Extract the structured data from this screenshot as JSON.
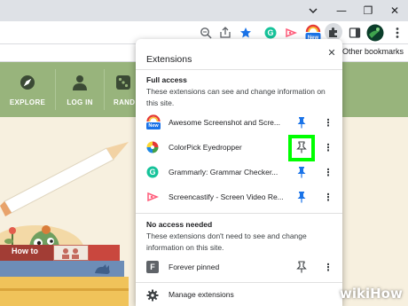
{
  "browser": {
    "window_controls": {
      "minimize": "—",
      "restore": "❐",
      "close": "✕"
    },
    "bookmarks_bar": {
      "other_bookmarks": "Other bookmarks"
    },
    "toolbar_icons": [
      "zoom-icon",
      "share-icon",
      "star-icon",
      "grammarly-icon",
      "screencastify-icon",
      "awesome-screenshot-icon",
      "puzzle-icon",
      "sidebar-icon",
      "profile-icon",
      "menu-icon"
    ],
    "new_badge": "New"
  },
  "website": {
    "nav": [
      {
        "label": "EXPLORE",
        "icon": "compass-icon"
      },
      {
        "label": "LOG IN",
        "icon": "person-icon"
      },
      {
        "label": "RAND",
        "icon": "dice-icon"
      }
    ],
    "book_label": "How to",
    "colors": {
      "nav_green": "#98b47c",
      "background": "#f7f0df"
    }
  },
  "extensions_popup": {
    "title": "Extensions",
    "close_label": "✕",
    "full_access": {
      "heading": "Full access",
      "description": "These extensions can see and change information on this site.",
      "items": [
        {
          "name": "Awesome Screenshot and Scre...",
          "icon": "awesome-screenshot-icon",
          "badge": "New",
          "pinned": true
        },
        {
          "name": "ColorPick Eyedropper",
          "icon": "colorpick-icon",
          "pinned": false,
          "highlighted": true
        },
        {
          "name": "Grammarly: Grammar Checker...",
          "icon": "grammarly-icon",
          "pinned": true
        },
        {
          "name": "Screencastify - Screen Video Re...",
          "icon": "screencastify-icon",
          "pinned": true
        }
      ]
    },
    "no_access": {
      "heading": "No access needed",
      "description": "These extensions don't need to see and change information on this site.",
      "items": [
        {
          "name": "Forever pinned",
          "icon": "forever-pinned-icon",
          "icon_letter": "F",
          "pinned": false
        }
      ]
    },
    "manage_label": "Manage extensions",
    "highlight_color": "#00ff00",
    "pin_color": "#1a73e8"
  },
  "watermark": "wikiHow"
}
